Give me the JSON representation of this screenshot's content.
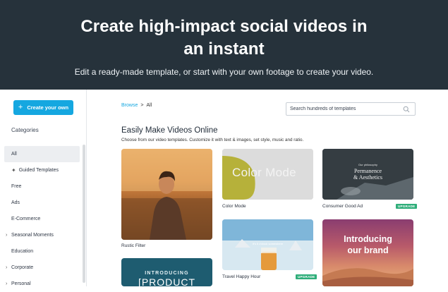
{
  "hero": {
    "title_line1": "Create high-impact social videos in",
    "title_line2": "an instant",
    "subtitle": "Edit a ready-made template, or start with your own footage to create your video."
  },
  "sidebar": {
    "create_button": "Create your own",
    "categories_heading": "Categories",
    "items": [
      {
        "label": "All",
        "active": true,
        "expandable": false
      },
      {
        "label": "Guided Templates",
        "icon": "magic-wand-icon",
        "expandable": false
      },
      {
        "label": "Free",
        "expandable": false
      },
      {
        "label": "Ads",
        "expandable": false
      },
      {
        "label": "E-Commerce",
        "expandable": false
      },
      {
        "label": "Seasonal Moments",
        "expandable": true
      },
      {
        "label": "Education",
        "expandable": false
      },
      {
        "label": "Corporate",
        "expandable": true
      },
      {
        "label": "Personal",
        "expandable": true
      }
    ]
  },
  "breadcrumb": {
    "root": "Browse",
    "separator": ">",
    "current": "All"
  },
  "search": {
    "placeholder": "Search hundreds of templates",
    "value": ""
  },
  "main": {
    "title": "Easily Make Videos Online",
    "subtitle": "Choose from our video templates. Customize it with text & images, set style, music and ratio."
  },
  "templates": [
    {
      "name": "Rustic Filter",
      "badge": ""
    },
    {
      "name": "Color Mode",
      "badge": "",
      "overlay_text": "Color Mode"
    },
    {
      "name": "Consumer Good Ad",
      "badge": "UPGRADE",
      "overlay_small": "Our philosophy",
      "overlay_line1": "Permanence",
      "overlay_line2": "& Aesthetics"
    },
    {
      "name": "Travel Happy Hour",
      "badge": "UPGRADE",
      "overlay_text": "It's 5 o'clock somewhere"
    },
    {
      "name": "",
      "badge": "",
      "overlay_line1": "Introducing",
      "overlay_line2": "our brand"
    },
    {
      "name": "",
      "badge": "",
      "overlay_line1": "INTRODUCING",
      "overlay_line2": "[PRODUCT"
    }
  ],
  "colors": {
    "hero_bg": "#26323b",
    "accent": "#15a7e0",
    "upgrade_badge": "#2fae7a"
  }
}
